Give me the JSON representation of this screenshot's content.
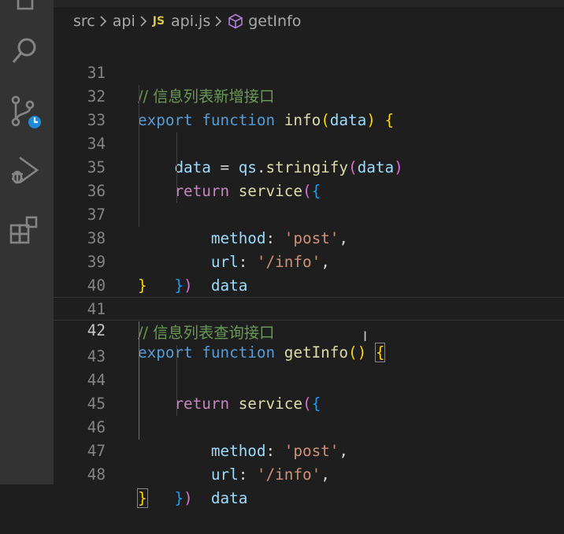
{
  "activity_bar": {
    "items": [
      {
        "name": "explorer-icon"
      },
      {
        "name": "search-icon"
      },
      {
        "name": "source-control-icon"
      },
      {
        "name": "run-debug-icon"
      },
      {
        "name": "extensions-icon"
      }
    ]
  },
  "breadcrumb": {
    "folder1": "src",
    "folder2": "api",
    "file_badge": "JS",
    "file": "api.js",
    "symbol": "getInfo"
  },
  "code": {
    "current_line": "42",
    "lines": [
      {
        "n": "31",
        "t": "// 信息列表新增接口"
      },
      {
        "n": "32",
        "t": "export function info(data) {"
      },
      {
        "n": "33",
        "t": "    data = qs.stringify(data)"
      },
      {
        "n": "34",
        "t": "    return service({"
      },
      {
        "n": "35",
        "t": "        method: 'post',"
      },
      {
        "n": "36",
        "t": "        url: '/info',"
      },
      {
        "n": "37",
        "t": "        data"
      },
      {
        "n": "38",
        "t": "    })"
      },
      {
        "n": "39",
        "t": "}"
      },
      {
        "n": "40",
        "t": ""
      },
      {
        "n": "41",
        "t": "// 信息列表查询接口"
      },
      {
        "n": "42",
        "t": "export function getInfo() {"
      },
      {
        "n": "43",
        "t": "    return service({"
      },
      {
        "n": "44",
        "t": "        method: 'post',"
      },
      {
        "n": "45",
        "t": "        url: '/info',"
      },
      {
        "n": "46",
        "t": "        data"
      },
      {
        "n": "47",
        "t": "    })"
      },
      {
        "n": "48",
        "t": "}"
      }
    ]
  },
  "colors": {
    "background": "#1e1e1e",
    "activity_bar": "#333333",
    "comment": "#6a9955",
    "keyword_control": "#c586c0",
    "keyword_storage": "#569cd6",
    "function": "#dcdcaa",
    "variable": "#9cdcfe",
    "string": "#ce9178",
    "bracket_level1": "#ffd700",
    "bracket_level2": "#da70d6",
    "bracket_level3": "#179fff"
  }
}
